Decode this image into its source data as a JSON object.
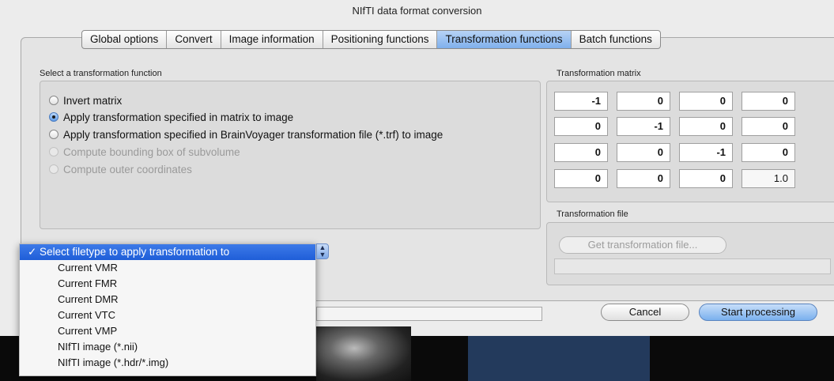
{
  "window": {
    "title": "NIfTI data format conversion"
  },
  "tabs": [
    {
      "label": "Global options",
      "active": false
    },
    {
      "label": "Convert",
      "active": false
    },
    {
      "label": "Image information",
      "active": false
    },
    {
      "label": "Positioning functions",
      "active": false
    },
    {
      "label": "Transformation functions",
      "active": true
    },
    {
      "label": "Batch functions",
      "active": false
    }
  ],
  "select_function": {
    "label": "Select a transformation function",
    "options": [
      {
        "label": "Invert matrix",
        "state": "enabled"
      },
      {
        "label": "Apply transformation specified in matrix to image",
        "state": "selected"
      },
      {
        "label": "Apply transformation specified in BrainVoyager transformation file (*.trf) to image",
        "state": "enabled"
      },
      {
        "label": "Compute bounding box of subvolume",
        "state": "disabled"
      },
      {
        "label": "Compute outer coordinates",
        "state": "disabled"
      }
    ]
  },
  "matrix": {
    "label": "Transformation matrix",
    "rows": [
      [
        "-1",
        "0",
        "0",
        "0"
      ],
      [
        "0",
        "-1",
        "0",
        "0"
      ],
      [
        "0",
        "0",
        "-1",
        "0"
      ],
      [
        "0",
        "0",
        "0",
        "1.0"
      ]
    ]
  },
  "transformation_file": {
    "label": "Transformation file",
    "button": "Get transformation file...",
    "path": ""
  },
  "filetype_dropdown": {
    "selected": "✓ Select filetype to apply transformation to",
    "options": [
      "Current VMR",
      "Current FMR",
      "Current DMR",
      "Current VTC",
      "Current VMP",
      "NIfTI image (*.nii)",
      "NIfTI image (*.hdr/*.img)"
    ]
  },
  "buttons": {
    "cancel": "Cancel",
    "start": "Start processing"
  },
  "colors": {
    "accent": "#3d7ae8",
    "tab_active": "#7fb0ec"
  }
}
